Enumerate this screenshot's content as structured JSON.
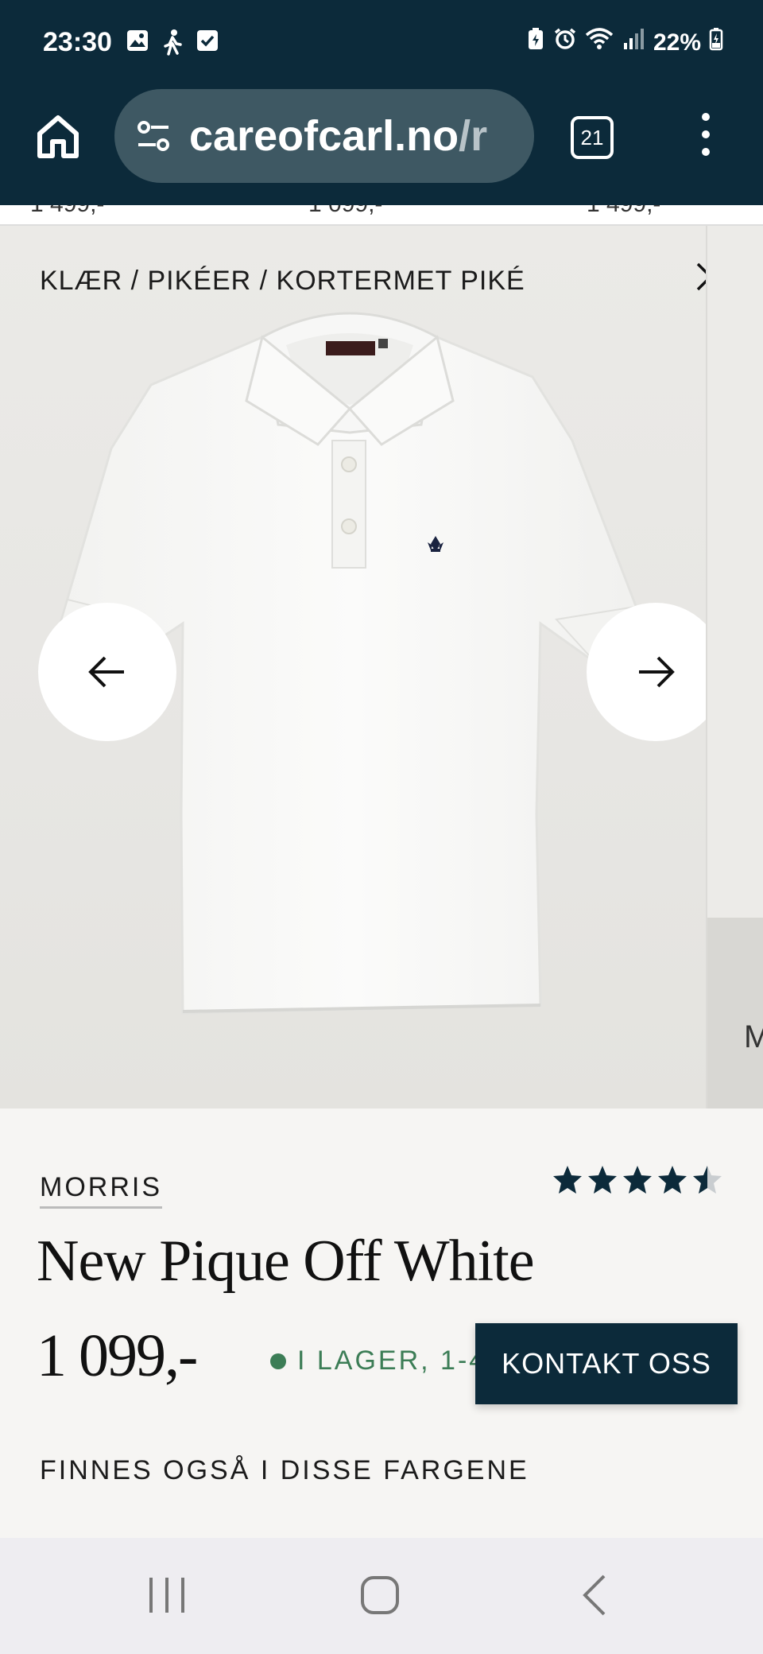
{
  "status_bar": {
    "time": "23:30",
    "battery": "22%",
    "left_icons": [
      "image-icon",
      "walking-icon",
      "checkbox-icon"
    ],
    "right_icons": [
      "battery-saver-icon",
      "alarm-icon",
      "wifi-icon",
      "signal-icon",
      "battery-icon"
    ]
  },
  "browser": {
    "url_main": "careofcarl.no",
    "url_rest": "/r",
    "tab_count": "21"
  },
  "previous_prices": [
    "1 499,-",
    "1 099,-",
    "1 499,-"
  ],
  "gallery": {
    "breadcrumb": "KLÆR / PIKÉER / KORTERMET PIKÉ",
    "peek_text": "M"
  },
  "product": {
    "brand": "MORRIS",
    "name": "New Pique Off White",
    "price": "1 099,-",
    "stock": "I LAGER, 1-4",
    "rating": 4.5,
    "contact_label": "KONTAKT OSS",
    "colors_heading": "FINNES OGSÅ I DISSE FARGENE"
  },
  "colors": {
    "brand_dark": "#0c2a3a",
    "stock_green": "#3c7d56"
  }
}
